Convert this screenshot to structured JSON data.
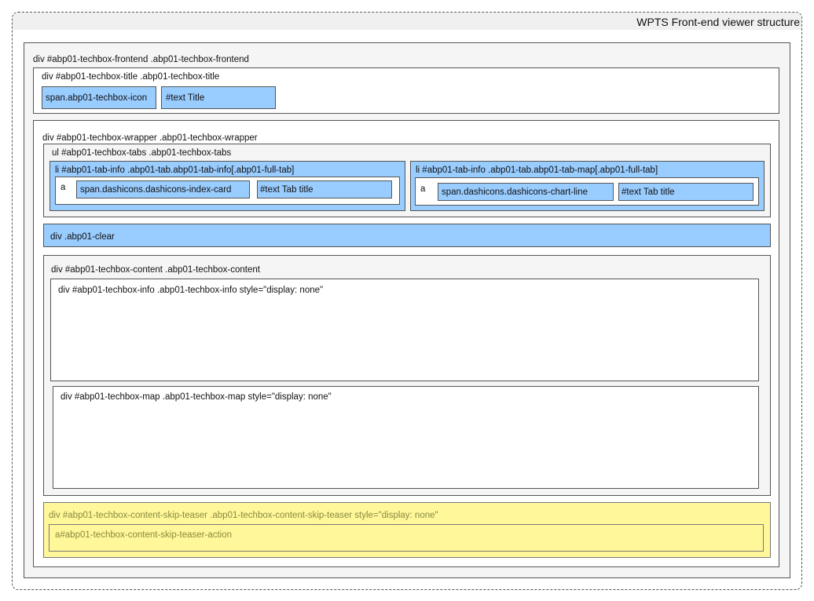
{
  "diagram": {
    "title": "WPTS Front-end viewer structure",
    "frontend": "div #abp01-techbox-frontend .abp01-techbox-frontend",
    "title_div": "div #abp01-techbox-title .abp01-techbox-title",
    "icon_span": "span.abp01-techbox-icon",
    "title_text": "#text Title",
    "wrapper": "div #abp01-techbox-wrapper .abp01-techbox-wrapper",
    "tabs": "ul #abp01-techbox-tabs .abp01-techbox-tabs",
    "tab_items": [
      {
        "li": "li #abp01-tab-info .abp01-tab.abp01-tab-info[.abp01-full-tab]",
        "a": "a",
        "icon": "span.dashicons.dashicons-index-card",
        "text": "#text Tab title"
      },
      {
        "li": "li #abp01-tab-info .abp01-tab.abp01-tab-map[.abp01-full-tab]",
        "a": "a",
        "icon": "span.dashicons.dashicons-chart-line",
        "text": "#text Tab title"
      }
    ],
    "clear": "div .abp01-clear",
    "content": "div #abp01-techbox-content .abp01-techbox-content",
    "info": "div #abp01-techbox-info .abp01-techbox-info style=\"display: none\"",
    "map": "div #abp01-techbox-map .abp01-techbox-map style=\"display: none\"",
    "skip_teaser": "div #abp01-techbox-content-skip-teaser .abp01-techbox-content-skip-teaser style=\"display: none\"",
    "skip_action": "a#abp01-techbox-content-skip-teaser-action"
  },
  "colors": {
    "highlight_blue": "#99ccff",
    "container_grey": "#f5f5f5",
    "teaser_yellow": "#fff799"
  }
}
